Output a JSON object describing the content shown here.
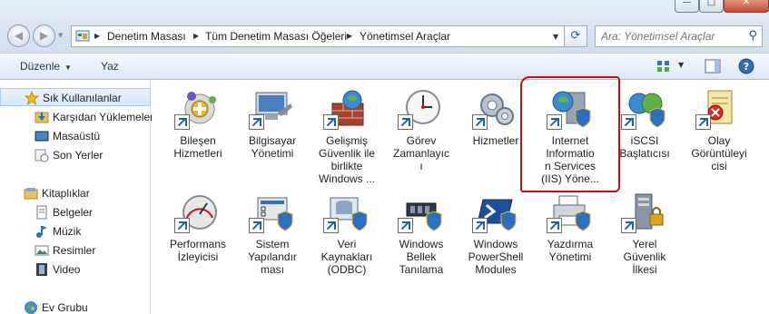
{
  "window": {
    "controls": {
      "minimize": "—",
      "maximize": "□",
      "close": "✕"
    }
  },
  "address": {
    "breadcrumbs": [
      "Denetim Masası",
      "Tüm Denetim Masası Öğeleri",
      "Yönetimsel Araçlar"
    ],
    "search_placeholder": "Ara: Yönetimsel Araçlar"
  },
  "toolbar": {
    "organize_label": "Düzenle",
    "burn_label": "Yaz"
  },
  "sidebar": {
    "favorites_header": "Sık Kullanılanlar",
    "favorites": [
      "Karşıdan Yüklemeler",
      "Masaüstü",
      "Son Yerler"
    ],
    "libraries_header": "Kitaplıklar",
    "libraries": [
      "Belgeler",
      "Müzik",
      "Resimler",
      "Video"
    ],
    "homegroup": "Ev Grubu"
  },
  "items": [
    {
      "label": "Bileşen\nHizmetleri",
      "icon": "component-services-icon"
    },
    {
      "label": "Bilgisayar\nYönetimi",
      "icon": "computer-management-icon"
    },
    {
      "label": "Gelişmiş\nGüvenlik ile\nbirlikte\nWindows ...",
      "icon": "firewall-icon"
    },
    {
      "label": "Görev\nZamanlayıc\nı",
      "icon": "task-scheduler-icon"
    },
    {
      "label": "Hizmetler",
      "icon": "services-icon"
    },
    {
      "label": "Internet\nInformatio\nn Services\n(IIS) Yöne...",
      "icon": "iis-icon"
    },
    {
      "label": "iSCSI\nBaşlatıcısı",
      "icon": "iscsi-icon"
    },
    {
      "label": "Olay\nGörüntüleyi\ncisi",
      "icon": "event-viewer-icon"
    },
    {
      "label": "Performans\nİzleyicisi",
      "icon": "performance-monitor-icon"
    },
    {
      "label": "Sistem\nYapılandır\nması",
      "icon": "system-configuration-icon"
    },
    {
      "label": "Veri\nKaynakları\n(ODBC)",
      "icon": "odbc-icon"
    },
    {
      "label": "Windows\nBellek\nTanılama",
      "icon": "memory-diagnostic-icon"
    },
    {
      "label": "Windows\nPowerShell\nModules",
      "icon": "powershell-icon"
    },
    {
      "label": "Yazdırma\nYönetimi",
      "icon": "print-management-icon"
    },
    {
      "label": "Yerel\nGüvenlik\nİlkesi",
      "icon": "local-security-policy-icon"
    }
  ],
  "colors": {
    "annotation": "#c8101b",
    "accent": "#1a62b8"
  }
}
